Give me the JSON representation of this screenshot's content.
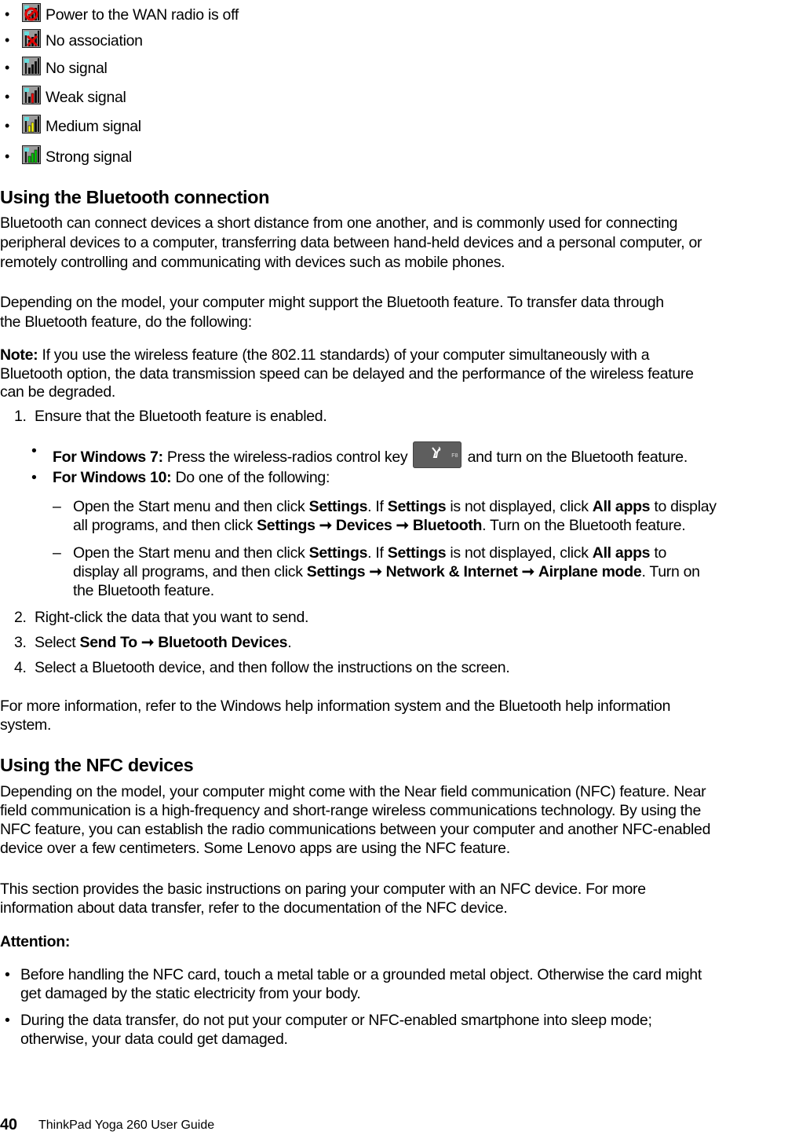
{
  "signal_states": [
    {
      "icon": "wan-radio-off-icon",
      "label": "Power to the WAN radio is off"
    },
    {
      "icon": "no-association-icon",
      "label": "No association"
    },
    {
      "icon": "no-signal-icon",
      "label": "No signal"
    },
    {
      "icon": "weak-signal-icon",
      "label": "Weak signal"
    },
    {
      "icon": "medium-signal-icon",
      "label": "Medium signal"
    },
    {
      "icon": "strong-signal-icon",
      "label": "Strong signal"
    }
  ],
  "signal_colors": {
    "weak": "#ff0000",
    "medium": "#ffff00",
    "strong": "#00cc00",
    "antenna": "#66dddd",
    "off": "#e00000"
  },
  "bluetooth": {
    "heading": "Using the Bluetooth connection",
    "intro": [
      "Bluetooth can connect devices a short distance from one another, and is commonly used for connecting",
      "peripheral devices to a computer, transferring data between hand-held devices and a personal computer, or",
      "remotely controlling and communicating with devices such as mobile phones."
    ],
    "model_para": [
      "Depending on the model, your computer might support the Bluetooth feature.  To transfer data through",
      "the Bluetooth feature, do the following:"
    ],
    "note_label": "Note:",
    "note": [
      " If you use the wireless feature (the 802.11 standards) of your computer simultaneously with a",
      "Bluetooth option, the data transmission speed can be delayed and the performance of the wireless feature",
      "can be degraded."
    ],
    "step1": {
      "num": "1.",
      "text": "Ensure that the Bluetooth feature is enabled."
    },
    "win7": {
      "label": "For Windows 7:",
      "before": " Press the wireless-radios control key ",
      "key_label": "F8",
      "after": " and turn on the Bluetooth feature."
    },
    "win10": {
      "label": "For Windows 10:",
      "text": " Do one of the following:"
    },
    "option1": {
      "dash": "–",
      "l1_a": "Open the Start menu and then click ",
      "l1_b": "Settings",
      "l1_c": ". If ",
      "l1_d": "Settings",
      "l1_e": " is not displayed, click ",
      "l1_f": "All apps",
      "l1_g": " to display",
      "l2_a": "all programs, and then click ",
      "l2_b": "Settings",
      "l2_c": "Devices",
      "l2_d": "Bluetooth",
      "l2_e": ". Turn on the Bluetooth feature."
    },
    "option2": {
      "dash": "–",
      "l1_a": "Open the Start menu and then click ",
      "l1_b": "Settings",
      "l1_c": ".  If ",
      "l1_d": "Settings",
      "l1_e": " is not displayed, click ",
      "l1_f": "All apps",
      "l1_g": " to",
      "l2_a": "display all programs, and then click ",
      "l2_b": "Settings",
      "l2_c": "Network & Internet",
      "l2_d": "Airplane mode",
      "l2_e": ". Turn on",
      "l3": "the Bluetooth feature."
    },
    "arrow": "➞",
    "step2": {
      "num": "2.",
      "text": "Right-click the data that you want to send."
    },
    "step3": {
      "num": "3.",
      "before": "Select ",
      "b1": "Send To",
      "b2": "Bluetooth Devices",
      "after": "."
    },
    "step4": {
      "num": "4.",
      "text": "Select a Bluetooth device, and then follow the instructions on the screen."
    },
    "more_info": [
      "For more information, refer to the Windows help information system and the Bluetooth help information",
      "system."
    ]
  },
  "nfc": {
    "heading": "Using the NFC devices",
    "intro": [
      "Depending on the model, your computer might come with the Near field communication (NFC) feature.  Near",
      "field communication is a high-frequency and short-range wireless communications technology.  By using the",
      "NFC feature, you can establish the radio communications between your computer and another NFC-enabled",
      "device over a few centimeters.  Some Lenovo apps are using the NFC feature."
    ],
    "section_para": [
      "This section provides the basic instructions on paring your computer with an NFC device.  For more",
      "information about data transfer, refer to the documentation of the NFC device."
    ],
    "attention_label": "Attention:",
    "attention_items": [
      [
        "Before handling the NFC card, touch a metal table or a grounded metal object.  Otherwise the card might",
        "get damaged by the static electricity from your body."
      ],
      [
        "During the data transfer, do not put your computer or NFC-enabled smartphone into sleep mode;",
        "otherwise, your data could get damaged."
      ]
    ]
  },
  "footer": {
    "page_number": "40",
    "title": "ThinkPad Yoga 260 User Guide"
  }
}
